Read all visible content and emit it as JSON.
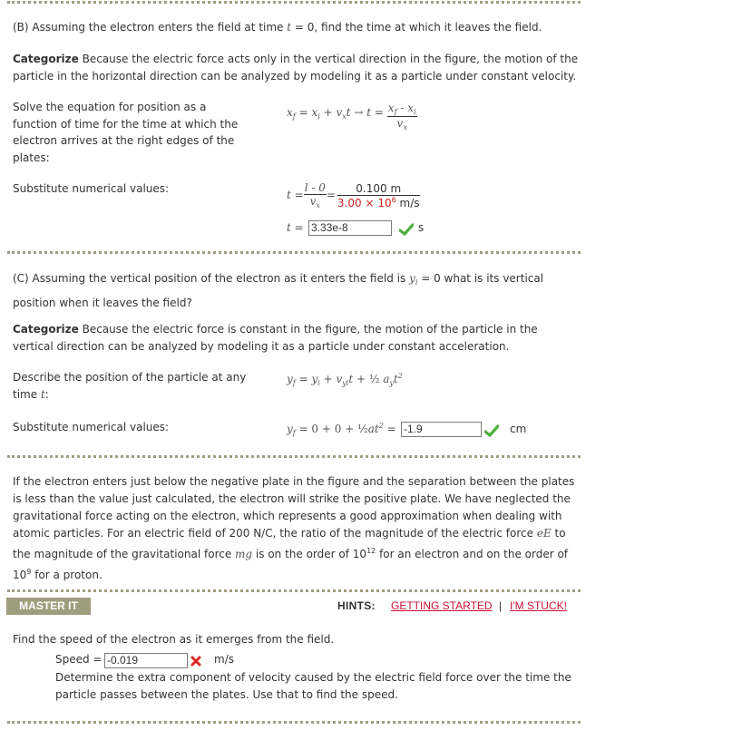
{
  "partB": {
    "question": "(B) Assuming the electron enters the field at time ",
    "question_var": "t",
    "question_rest": " = 0, find the time at which it leaves the field.",
    "categorize_label": "Categorize",
    "categorize_text": " Because the electric force acts only in the vertical direction in the figure, the motion of the particle in the horizontal direction can be analyzed by modeling it as a particle under constant velocity.",
    "step1_label": "Solve the equation for position as a function of time for the time at which the electron arrives at the right edges of the plates:",
    "step2_label": "Substitute numerical values:",
    "fraction_numerator": "0.100 m",
    "fraction_denominator_value": "3.00 × 10",
    "fraction_denominator_exp": "6",
    "fraction_denominator_unit": " m/s",
    "symbolic_numerator": "l - 0",
    "answer": {
      "value": "3.33e-8",
      "unit": "s",
      "status": "correct"
    }
  },
  "partC": {
    "question_pre": "(C) Assuming the vertical position of the electron as it enters the field is ",
    "question_var": "y",
    "question_sub": "i",
    "question_post": " = 0 what is its vertical position when it leaves the field?",
    "categorize_label": "Categorize",
    "categorize_text": " Because the electric force is constant in the figure, the motion of the particle in the vertical direction can be analyzed by modeling it as a particle under constant acceleration.",
    "step1_label_pre": "Describe the position of the particle at any time ",
    "step1_var": "t",
    "step1_post": ":",
    "step2_label": "Substitute numerical values:",
    "substitution": "= 0 + 0 + ½at² =",
    "answer": {
      "value": "-1.9",
      "unit": "cm",
      "status": "correct"
    }
  },
  "discussion": {
    "text1": "If the electron enters just below the negative plate in the figure and the separation between the plates is less than the value just calculated, the electron will strike the positive plate. We have neglected the gravitational force acting on the electron, which represents a good approximation when dealing with atomic particles. For an electric field of 200 N/C, the ratio of the magnitude of the electric force ",
    "var1": "eE",
    "text2": " to the magnitude of the gravitational force ",
    "var2": "mg",
    "text3": " is on the order of 10",
    "exp1": "12",
    "text4": " for an electron and on the order of 10",
    "exp2": "9",
    "text5": " for a proton."
  },
  "master_it": {
    "button_label": "MASTER IT",
    "hints_label": "HINTS:",
    "hint_links": [
      "GETTING STARTED",
      "I'M STUCK!"
    ],
    "separator": "|",
    "question": "Find the speed of the electron as it emerges from the field.",
    "speed_label": "Speed =",
    "answer": {
      "value": "-0.019",
      "unit": "m/s",
      "status": "incorrect"
    },
    "feedback": "Determine the extra component of velocity caused by the electric field force over the time the particle passes between the plates. Use that to find the speed."
  },
  "colors": {
    "divider": "#a09d85",
    "master_button": "#a09d7e",
    "hint_link": "#cc1133",
    "correct": "#4caf3a",
    "incorrect": "#e02828",
    "highlight_value": "#cc2222"
  }
}
